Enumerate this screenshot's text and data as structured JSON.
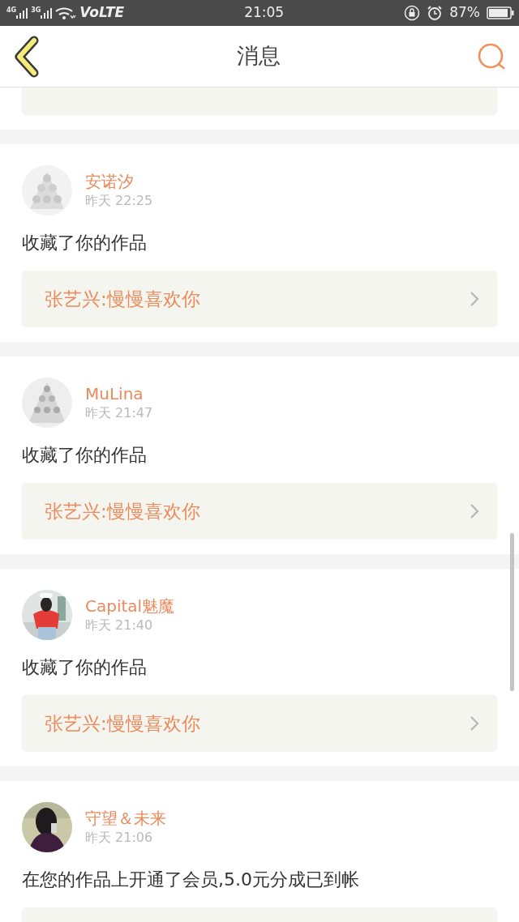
{
  "status_bar": {
    "sim_1": "4G",
    "sim_2": "3G",
    "network": "VoLTE",
    "time": "21:05",
    "battery": "87%"
  },
  "header": {
    "title": "消息"
  },
  "top_card_cut": true,
  "messages": [
    {
      "user": "安诺汐",
      "time": "昨天 22:25",
      "text": "收藏了你的作品",
      "work": "张艺兴:慢慢喜欢你"
    },
    {
      "user": "MuLina",
      "time": "昨天 21:47",
      "text": "收藏了你的作品",
      "work": "张艺兴:慢慢喜欢你"
    },
    {
      "user": "Capital魅魔",
      "time": "昨天 21:40",
      "text": "收藏了你的作品",
      "work": "张艺兴:慢慢喜欢你"
    },
    {
      "user": "守望＆未来",
      "time": "昨天 21:06",
      "text": "在您的作品上开通了会员,5.0元分成已到帐"
    }
  ]
}
